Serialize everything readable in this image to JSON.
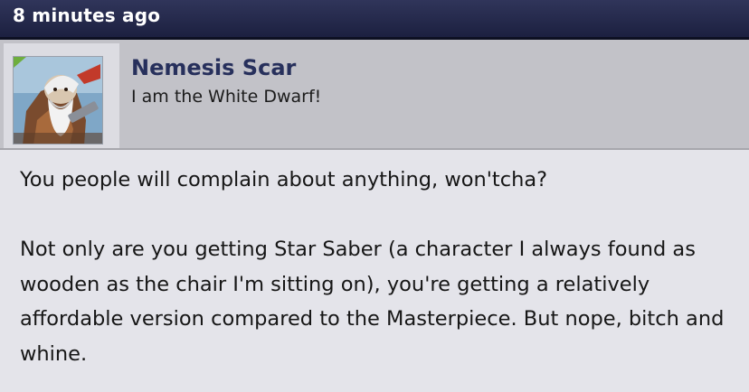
{
  "post": {
    "timestamp": "8 minutes ago",
    "author": {
      "name": "Nemesis Scar",
      "title": "I am the White Dwarf!",
      "avatar_icon": "avatar-white-dwarf-icon"
    },
    "body": {
      "paragraphs": [
        "You people will complain about anything, won'tcha?",
        "Not only are you getting Star Saber (a character I always found as wooden as the chair I'm sitting on), you're getting a relatively affordable version compared to the Masterpiece. But nope, bitch and whine."
      ]
    }
  },
  "colors": {
    "header_bg": "#1c2040",
    "author_bg": "#c2c2c8",
    "body_bg": "#e4e4ea",
    "author_name": "#27305c"
  }
}
